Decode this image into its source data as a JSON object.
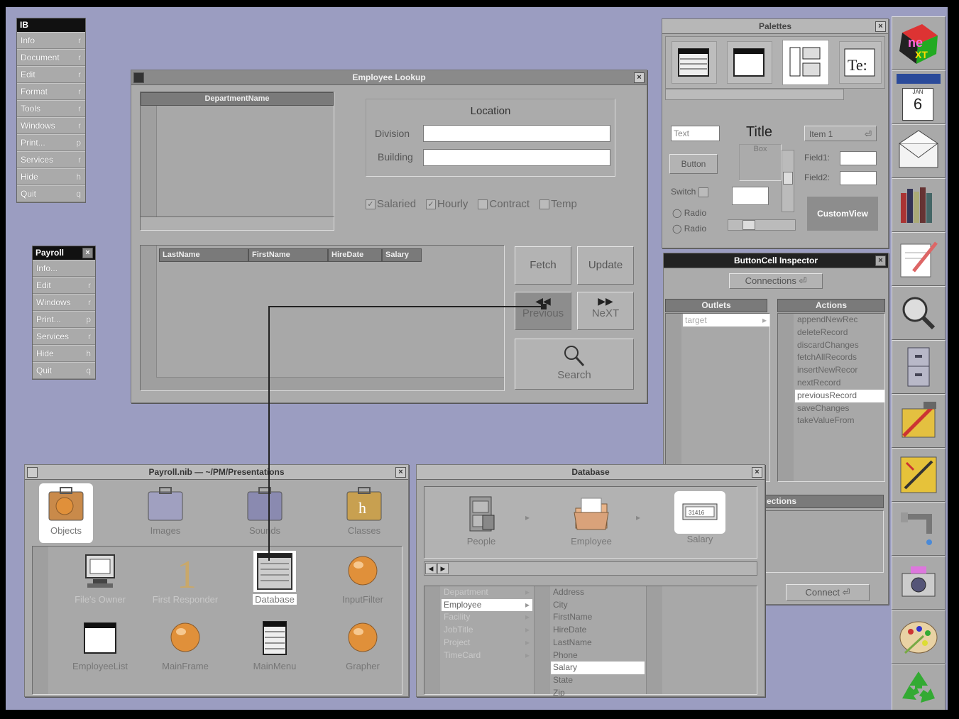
{
  "main_menu": {
    "title": "IB",
    "items": [
      {
        "label": "Info",
        "key": "r"
      },
      {
        "label": "Document",
        "key": "r"
      },
      {
        "label": "Edit",
        "key": "r"
      },
      {
        "label": "Format",
        "key": "r"
      },
      {
        "label": "Tools",
        "key": "r"
      },
      {
        "label": "Windows",
        "key": "r"
      },
      {
        "label": "Print...",
        "key": "p"
      },
      {
        "label": "Services",
        "key": "r"
      },
      {
        "label": "Hide",
        "key": "h"
      },
      {
        "label": "Quit",
        "key": "q"
      }
    ]
  },
  "payroll_menu": {
    "title": "Payroll",
    "items": [
      {
        "label": "Info...",
        "key": ""
      },
      {
        "label": "Edit",
        "key": "r"
      },
      {
        "label": "Windows",
        "key": "r"
      },
      {
        "label": "Print...",
        "key": "p"
      },
      {
        "label": "Services",
        "key": "r"
      },
      {
        "label": "Hide",
        "key": "h"
      },
      {
        "label": "Quit",
        "key": "q"
      }
    ]
  },
  "employee_lookup": {
    "title": "Employee Lookup",
    "dept_header": "DepartmentName",
    "location_title": "Location",
    "division_label": "Division",
    "building_label": "Building",
    "checks": [
      {
        "label": "Salaried",
        "checked": true
      },
      {
        "label": "Hourly",
        "checked": true
      },
      {
        "label": "Contract",
        "checked": false
      },
      {
        "label": "Temp",
        "checked": false
      }
    ],
    "columns": [
      "LastName",
      "FirstName",
      "HireDate",
      "Salary"
    ],
    "fetch": "Fetch",
    "update": "Update",
    "previous": "Previous",
    "next": "NeXT",
    "search": "Search"
  },
  "palettes": {
    "title": "Palettes",
    "text": "Text",
    "title_label": "Title",
    "item": "Item 1",
    "box": "Box",
    "button": "Button",
    "field1": "Field1:",
    "field2": "Field2:",
    "switch": "Switch",
    "radio1": "Radio",
    "radio2": "Radio",
    "custom": "CustomView"
  },
  "inspector": {
    "title": "ButtonCell Inspector",
    "popup": "Connections",
    "outlets_header": "Outlets",
    "actions_header": "Actions",
    "outlets": [
      "target"
    ],
    "actions": [
      "appendNewRec",
      "deleteRecord",
      "discardChanges",
      "fetchAllRecords",
      "insertNewRecor",
      "nextRecord",
      "previousRecord",
      "saveChanges",
      "takeValueFrom"
    ],
    "selected_action": "previousRecord",
    "connections_label": "ections",
    "connect": "Connect"
  },
  "payroll_nib": {
    "title": "Payroll.nib — ~/PM/Presentations",
    "tabs": [
      "Objects",
      "Images",
      "Sounds",
      "Classes"
    ],
    "objects": [
      "File's Owner",
      "First Responder",
      "Database",
      "InputFilter",
      "EmployeeList",
      "MainFrame",
      "MainMenu",
      "Grapher"
    ]
  },
  "database": {
    "title": "Database",
    "path": [
      "People",
      "Employee",
      "Salary"
    ],
    "entities": [
      "Department",
      "Employee",
      "Facility",
      "JobTitle",
      "Project",
      "TimeCard"
    ],
    "selected_entity": "Employee",
    "attributes": [
      "Address",
      "City",
      "FirstName",
      "HireDate",
      "LastName",
      "Phone",
      "Salary",
      "State",
      "Zip"
    ],
    "selected_attribute": "Salary"
  },
  "dock": {
    "calendar_day": "6",
    "calendar_month": "JAN"
  }
}
